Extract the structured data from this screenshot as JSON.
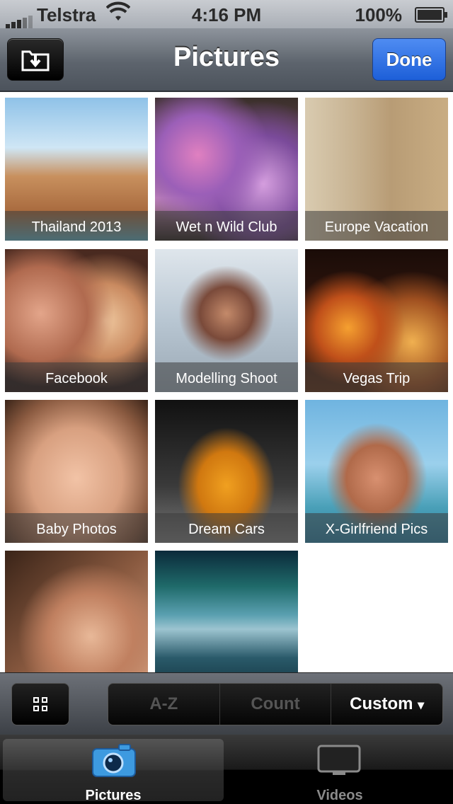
{
  "status_bar": {
    "carrier": "Telstra",
    "time": "4:16 PM",
    "battery": "100%"
  },
  "nav": {
    "title": "Pictures",
    "done_label": "Done"
  },
  "albums": [
    {
      "caption": "Thailand 2013",
      "icon": "beach-couple-photo"
    },
    {
      "caption": "Wet n Wild Club",
      "icon": "club-crowd-photo"
    },
    {
      "caption": "Europe Vacation",
      "icon": "ruins-architecture-photo"
    },
    {
      "caption": "Facebook",
      "icon": "friends-singing-photo"
    },
    {
      "caption": "Modelling Shoot",
      "icon": "snow-model-photo"
    },
    {
      "caption": "Vegas Trip",
      "icon": "vegas-night-photo"
    },
    {
      "caption": "Baby Photos",
      "icon": "baby-face-photo"
    },
    {
      "caption": "Dream Cars",
      "icon": "sports-car-photo"
    },
    {
      "caption": "X-Girlfriend Pics",
      "icon": "beach-woman-photo"
    },
    {
      "caption": "",
      "icon": "wet-hair-portrait-photo"
    },
    {
      "caption": "",
      "icon": "aurora-mountains-photo"
    }
  ],
  "sort": {
    "options": [
      "A-Z",
      "Count",
      "Custom"
    ],
    "selected": "Custom",
    "selected_arrow": "▾"
  },
  "tabs": [
    {
      "label": "Pictures",
      "active": true
    },
    {
      "label": "Videos",
      "active": false
    }
  ],
  "colors": {
    "accent": "#1d5fd8",
    "toolbar": "#4c535c"
  }
}
